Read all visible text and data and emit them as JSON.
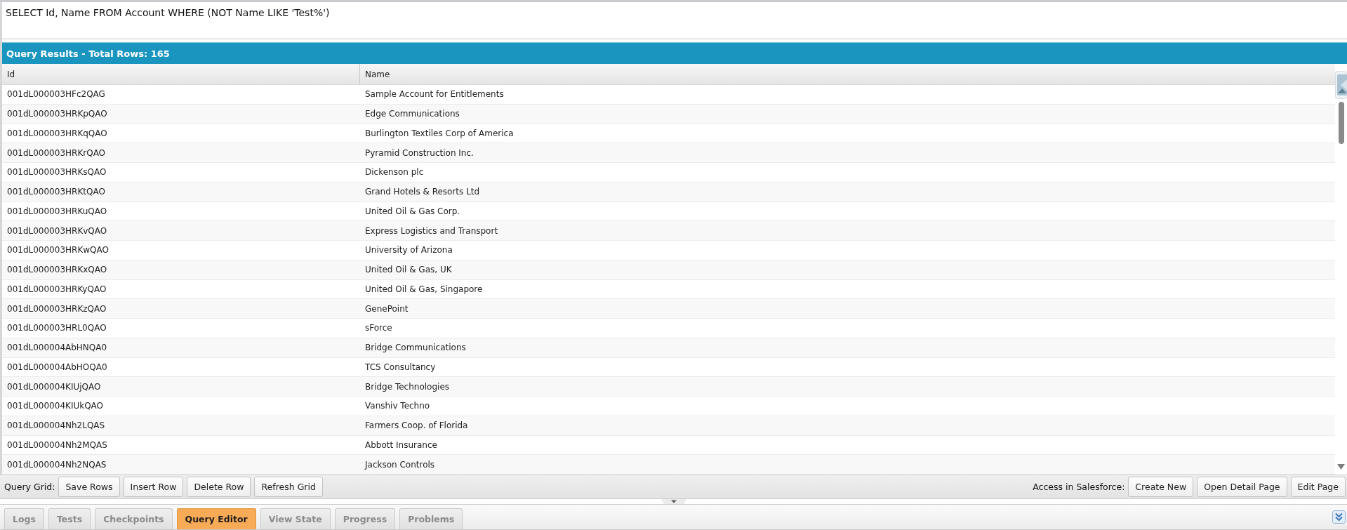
{
  "query_editor": {
    "value": "SELECT Id, Name FROM Account WHERE (NOT Name LIKE 'Test%')"
  },
  "results": {
    "title": "Query Results - Total Rows: 165",
    "columns": [
      "Id",
      "Name"
    ],
    "rows": [
      [
        "001dL000003HFc2QAG",
        "Sample Account for Entitlements"
      ],
      [
        "001dL000003HRKpQAO",
        "Edge Communications"
      ],
      [
        "001dL000003HRKqQAO",
        "Burlington Textiles Corp of America"
      ],
      [
        "001dL000003HRKrQAO",
        "Pyramid Construction Inc."
      ],
      [
        "001dL000003HRKsQAO",
        "Dickenson plc"
      ],
      [
        "001dL000003HRKtQAO",
        "Grand Hotels & Resorts Ltd"
      ],
      [
        "001dL000003HRKuQAO",
        "United Oil & Gas Corp."
      ],
      [
        "001dL000003HRKvQAO",
        "Express Logistics and Transport"
      ],
      [
        "001dL000003HRKwQAO",
        "University of Arizona"
      ],
      [
        "001dL000003HRKxQAO",
        "United Oil & Gas, UK"
      ],
      [
        "001dL000003HRKyQAO",
        "United Oil & Gas, Singapore"
      ],
      [
        "001dL000003HRKzQAO",
        "GenePoint"
      ],
      [
        "001dL000003HRL0QAO",
        "sForce"
      ],
      [
        "001dL000004AbHNQA0",
        "Bridge Communications"
      ],
      [
        "001dL000004AbHOQA0",
        "TCS Consultancy"
      ],
      [
        "001dL000004KIUjQAO",
        "Bridge Technologies"
      ],
      [
        "001dL000004KIUkQAO",
        "Vanshiv Techno"
      ],
      [
        "001dL000004Nh2LQAS",
        "Farmers Coop. of Florida"
      ],
      [
        "001dL000004Nh2MQAS",
        "Abbott Insurance"
      ],
      [
        "001dL000004Nh2NQAS",
        "Jackson Controls"
      ]
    ]
  },
  "toolbar": {
    "left_label": "Query Grid:",
    "left_buttons": [
      "Save Rows",
      "Insert Row",
      "Delete Row",
      "Refresh Grid"
    ],
    "right_label": "Access in Salesforce:",
    "right_buttons": [
      "Create New",
      "Open Detail Page",
      "Edit Page"
    ]
  },
  "tabs": [
    {
      "label": "Logs",
      "selected": false
    },
    {
      "label": "Tests",
      "selected": false
    },
    {
      "label": "Checkpoints",
      "selected": false
    },
    {
      "label": "Query Editor",
      "selected": true
    },
    {
      "label": "View State",
      "selected": false
    },
    {
      "label": "Progress",
      "selected": false
    },
    {
      "label": "Problems",
      "selected": false
    }
  ]
}
